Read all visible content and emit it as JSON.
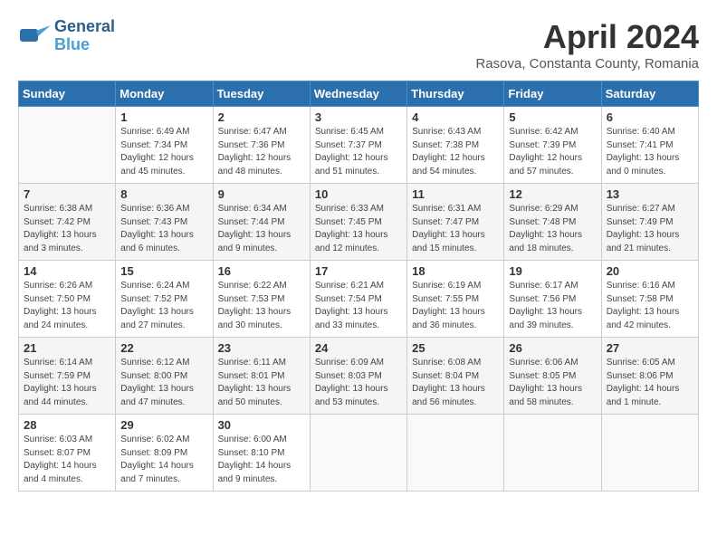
{
  "header": {
    "logo_line1": "General",
    "logo_line2": "Blue",
    "month": "April 2024",
    "location": "Rasova, Constanta County, Romania"
  },
  "days_of_week": [
    "Sunday",
    "Monday",
    "Tuesday",
    "Wednesday",
    "Thursday",
    "Friday",
    "Saturday"
  ],
  "weeks": [
    [
      {
        "day": "",
        "sunrise": "",
        "sunset": "",
        "daylight": ""
      },
      {
        "day": "1",
        "sunrise": "Sunrise: 6:49 AM",
        "sunset": "Sunset: 7:34 PM",
        "daylight": "Daylight: 12 hours and 45 minutes."
      },
      {
        "day": "2",
        "sunrise": "Sunrise: 6:47 AM",
        "sunset": "Sunset: 7:36 PM",
        "daylight": "Daylight: 12 hours and 48 minutes."
      },
      {
        "day": "3",
        "sunrise": "Sunrise: 6:45 AM",
        "sunset": "Sunset: 7:37 PM",
        "daylight": "Daylight: 12 hours and 51 minutes."
      },
      {
        "day": "4",
        "sunrise": "Sunrise: 6:43 AM",
        "sunset": "Sunset: 7:38 PM",
        "daylight": "Daylight: 12 hours and 54 minutes."
      },
      {
        "day": "5",
        "sunrise": "Sunrise: 6:42 AM",
        "sunset": "Sunset: 7:39 PM",
        "daylight": "Daylight: 12 hours and 57 minutes."
      },
      {
        "day": "6",
        "sunrise": "Sunrise: 6:40 AM",
        "sunset": "Sunset: 7:41 PM",
        "daylight": "Daylight: 13 hours and 0 minutes."
      }
    ],
    [
      {
        "day": "7",
        "sunrise": "Sunrise: 6:38 AM",
        "sunset": "Sunset: 7:42 PM",
        "daylight": "Daylight: 13 hours and 3 minutes."
      },
      {
        "day": "8",
        "sunrise": "Sunrise: 6:36 AM",
        "sunset": "Sunset: 7:43 PM",
        "daylight": "Daylight: 13 hours and 6 minutes."
      },
      {
        "day": "9",
        "sunrise": "Sunrise: 6:34 AM",
        "sunset": "Sunset: 7:44 PM",
        "daylight": "Daylight: 13 hours and 9 minutes."
      },
      {
        "day": "10",
        "sunrise": "Sunrise: 6:33 AM",
        "sunset": "Sunset: 7:45 PM",
        "daylight": "Daylight: 13 hours and 12 minutes."
      },
      {
        "day": "11",
        "sunrise": "Sunrise: 6:31 AM",
        "sunset": "Sunset: 7:47 PM",
        "daylight": "Daylight: 13 hours and 15 minutes."
      },
      {
        "day": "12",
        "sunrise": "Sunrise: 6:29 AM",
        "sunset": "Sunset: 7:48 PM",
        "daylight": "Daylight: 13 hours and 18 minutes."
      },
      {
        "day": "13",
        "sunrise": "Sunrise: 6:27 AM",
        "sunset": "Sunset: 7:49 PM",
        "daylight": "Daylight: 13 hours and 21 minutes."
      }
    ],
    [
      {
        "day": "14",
        "sunrise": "Sunrise: 6:26 AM",
        "sunset": "Sunset: 7:50 PM",
        "daylight": "Daylight: 13 hours and 24 minutes."
      },
      {
        "day": "15",
        "sunrise": "Sunrise: 6:24 AM",
        "sunset": "Sunset: 7:52 PM",
        "daylight": "Daylight: 13 hours and 27 minutes."
      },
      {
        "day": "16",
        "sunrise": "Sunrise: 6:22 AM",
        "sunset": "Sunset: 7:53 PM",
        "daylight": "Daylight: 13 hours and 30 minutes."
      },
      {
        "day": "17",
        "sunrise": "Sunrise: 6:21 AM",
        "sunset": "Sunset: 7:54 PM",
        "daylight": "Daylight: 13 hours and 33 minutes."
      },
      {
        "day": "18",
        "sunrise": "Sunrise: 6:19 AM",
        "sunset": "Sunset: 7:55 PM",
        "daylight": "Daylight: 13 hours and 36 minutes."
      },
      {
        "day": "19",
        "sunrise": "Sunrise: 6:17 AM",
        "sunset": "Sunset: 7:56 PM",
        "daylight": "Daylight: 13 hours and 39 minutes."
      },
      {
        "day": "20",
        "sunrise": "Sunrise: 6:16 AM",
        "sunset": "Sunset: 7:58 PM",
        "daylight": "Daylight: 13 hours and 42 minutes."
      }
    ],
    [
      {
        "day": "21",
        "sunrise": "Sunrise: 6:14 AM",
        "sunset": "Sunset: 7:59 PM",
        "daylight": "Daylight: 13 hours and 44 minutes."
      },
      {
        "day": "22",
        "sunrise": "Sunrise: 6:12 AM",
        "sunset": "Sunset: 8:00 PM",
        "daylight": "Daylight: 13 hours and 47 minutes."
      },
      {
        "day": "23",
        "sunrise": "Sunrise: 6:11 AM",
        "sunset": "Sunset: 8:01 PM",
        "daylight": "Daylight: 13 hours and 50 minutes."
      },
      {
        "day": "24",
        "sunrise": "Sunrise: 6:09 AM",
        "sunset": "Sunset: 8:03 PM",
        "daylight": "Daylight: 13 hours and 53 minutes."
      },
      {
        "day": "25",
        "sunrise": "Sunrise: 6:08 AM",
        "sunset": "Sunset: 8:04 PM",
        "daylight": "Daylight: 13 hours and 56 minutes."
      },
      {
        "day": "26",
        "sunrise": "Sunrise: 6:06 AM",
        "sunset": "Sunset: 8:05 PM",
        "daylight": "Daylight: 13 hours and 58 minutes."
      },
      {
        "day": "27",
        "sunrise": "Sunrise: 6:05 AM",
        "sunset": "Sunset: 8:06 PM",
        "daylight": "Daylight: 14 hours and 1 minute."
      }
    ],
    [
      {
        "day": "28",
        "sunrise": "Sunrise: 6:03 AM",
        "sunset": "Sunset: 8:07 PM",
        "daylight": "Daylight: 14 hours and 4 minutes."
      },
      {
        "day": "29",
        "sunrise": "Sunrise: 6:02 AM",
        "sunset": "Sunset: 8:09 PM",
        "daylight": "Daylight: 14 hours and 7 minutes."
      },
      {
        "day": "30",
        "sunrise": "Sunrise: 6:00 AM",
        "sunset": "Sunset: 8:10 PM",
        "daylight": "Daylight: 14 hours and 9 minutes."
      },
      {
        "day": "",
        "sunrise": "",
        "sunset": "",
        "daylight": ""
      },
      {
        "day": "",
        "sunrise": "",
        "sunset": "",
        "daylight": ""
      },
      {
        "day": "",
        "sunrise": "",
        "sunset": "",
        "daylight": ""
      },
      {
        "day": "",
        "sunrise": "",
        "sunset": "",
        "daylight": ""
      }
    ]
  ]
}
